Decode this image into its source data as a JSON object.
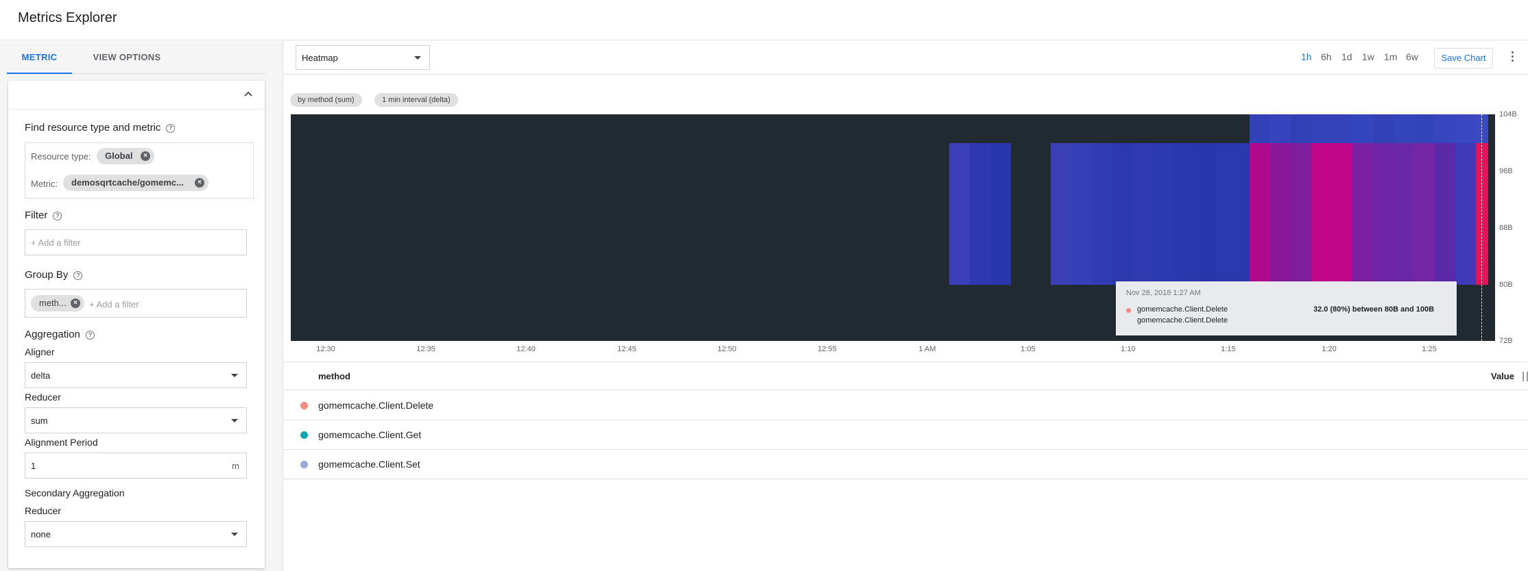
{
  "app": {
    "title": "Metrics Explorer"
  },
  "left_panel": {
    "tabs": [
      {
        "label": "METRIC",
        "active": true
      },
      {
        "label": "VIEW OPTIONS",
        "active": false
      }
    ],
    "find_section": {
      "label": "Find resource type and metric",
      "resource_type_label": "Resource type:",
      "resource_type_value": "Global",
      "metric_label": "Metric:",
      "metric_value": "demosqrtcache/gomemc..."
    },
    "filter": {
      "label": "Filter",
      "placeholder": "+ Add a filter"
    },
    "group_by": {
      "label": "Group By",
      "chip": "meth...",
      "placeholder": "+ Add a filter"
    },
    "aggregation": {
      "label": "Aggregation",
      "aligner_label": "Aligner",
      "aligner_value": "delta",
      "reducer_label": "Reducer",
      "reducer_value": "sum",
      "alignment_period_label": "Alignment Period",
      "alignment_period_value": "1",
      "alignment_period_unit": "m"
    },
    "secondary_aggregation": {
      "label": "Secondary Aggregation",
      "reducer_label": "Reducer",
      "reducer_value": "none"
    }
  },
  "toolbar": {
    "chart_type": "Heatmap",
    "time_ranges": [
      {
        "label": "1h",
        "active": true
      },
      {
        "label": "6h",
        "active": false
      },
      {
        "label": "1d",
        "active": false
      },
      {
        "label": "1w",
        "active": false
      },
      {
        "label": "1m",
        "active": false
      },
      {
        "label": "6w",
        "active": false
      }
    ],
    "save_label": "Save Chart"
  },
  "chart": {
    "pills": [
      "by method (sum)",
      "1 min interval (delta)"
    ],
    "tooltip": {
      "date": "Nov 28, 2018 1:27 AM",
      "series_name": "gomemcache.Client.Delete",
      "series_name_2": "gomemcache.Client.Delete",
      "value_text": "32.0  (80%)  between 80B and 100B"
    }
  },
  "chart_data": {
    "type": "heatmap",
    "x_ticks": [
      "12:30",
      "12:35",
      "12:40",
      "12:45",
      "12:50",
      "12:55",
      "1 AM",
      "1:05",
      "1:10",
      "1:15",
      "1:20",
      "1:25"
    ],
    "y_ticks": [
      "104B",
      "96B",
      "88B",
      "80B",
      "72B"
    ],
    "colors": {
      "background": "#222a31",
      "low": "#2a3bb0",
      "mid": "#6a2aa6",
      "high": "#e8115a"
    }
  },
  "legend": {
    "column_method": "method",
    "column_value": "Value",
    "rows": [
      {
        "name": "gomemcache.Client.Delete",
        "color": "#f28b82"
      },
      {
        "name": "gomemcache.Client.Get",
        "color": "#12a4af"
      },
      {
        "name": "gomemcache.Client.Set",
        "color": "#9fa8da"
      }
    ]
  }
}
